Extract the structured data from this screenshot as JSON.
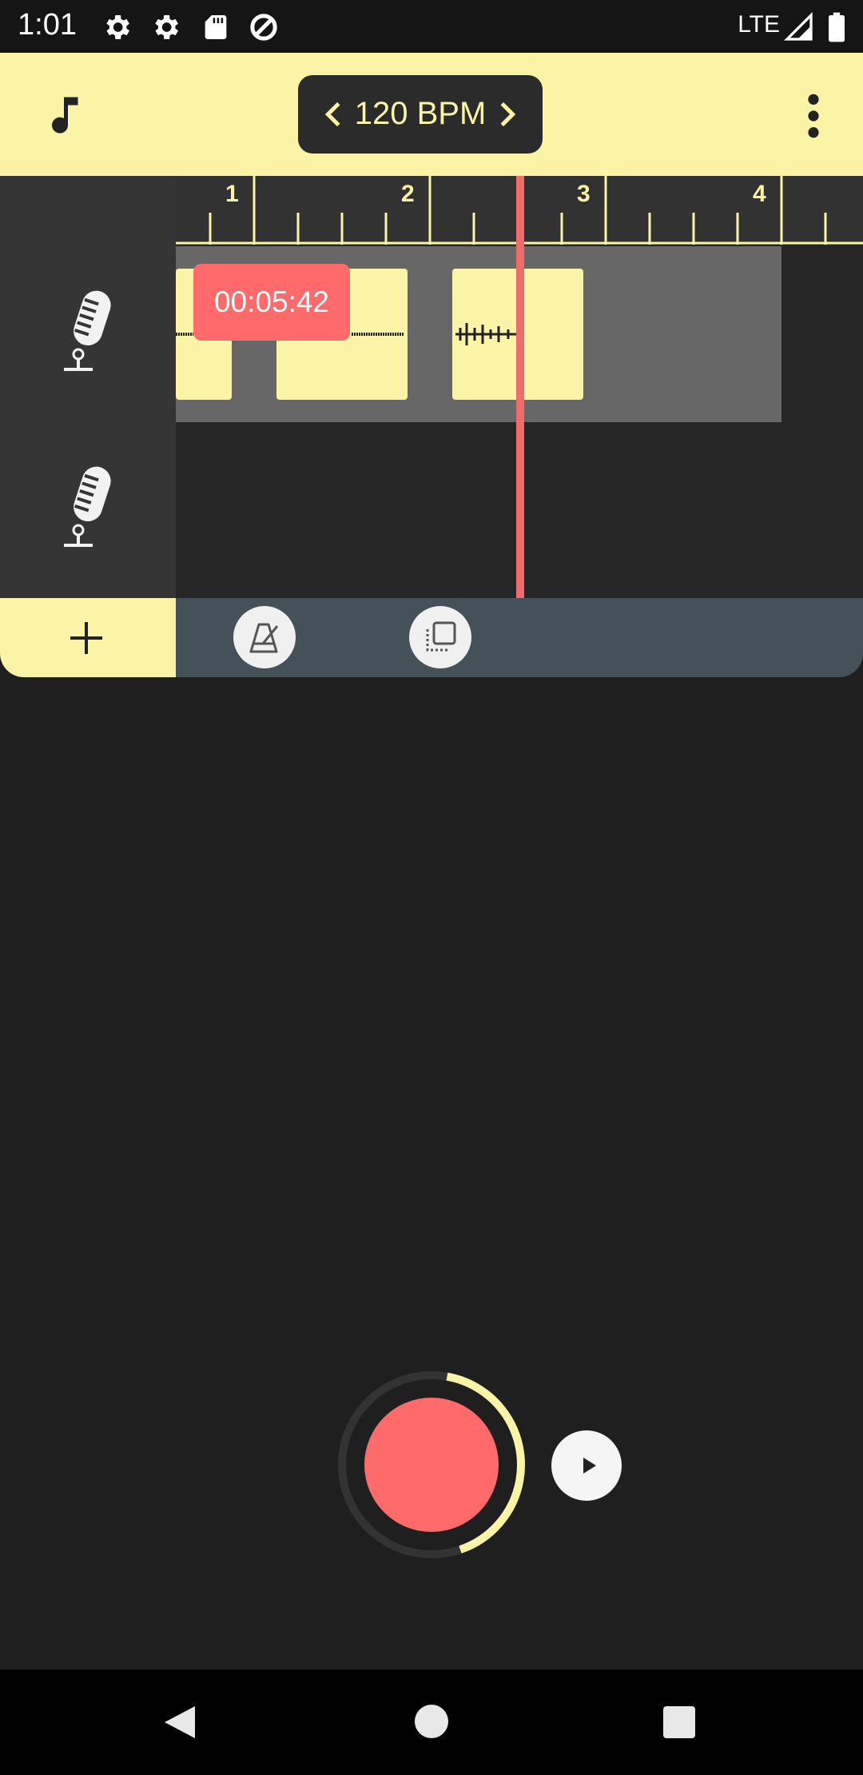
{
  "status_bar": {
    "time": "1:01",
    "network": "LTE",
    "icons": [
      "settings-icon",
      "settings-icon",
      "sd-card-icon",
      "data-saver-icon",
      "signal-icon",
      "battery-icon"
    ]
  },
  "app_bar": {
    "tempo_label": "120 BPM",
    "icons": [
      "music-note-icon",
      "chevron-left-icon",
      "chevron-right-icon",
      "more-vert-icon"
    ]
  },
  "timeline": {
    "bar_numbers": [
      "1",
      "2",
      "3",
      "4"
    ],
    "elapsed_time": "00:05:42",
    "colors": {
      "accent": "#fbf3a6",
      "playhead": "#f26b6b",
      "record": "#ff6b6b",
      "toolbar": "#455158"
    }
  },
  "tracks": [
    {
      "icon": "microphone-icon"
    },
    {
      "icon": "microphone-icon"
    }
  ],
  "toolbar": {
    "icons": [
      "add-icon",
      "metronome-icon",
      "copy-layers-icon"
    ]
  },
  "transport": {
    "record_progress": 0.42,
    "icons": [
      "record-icon",
      "play-icon"
    ]
  },
  "nav_bar": {
    "icons": [
      "back-icon",
      "home-icon",
      "recents-icon"
    ]
  }
}
